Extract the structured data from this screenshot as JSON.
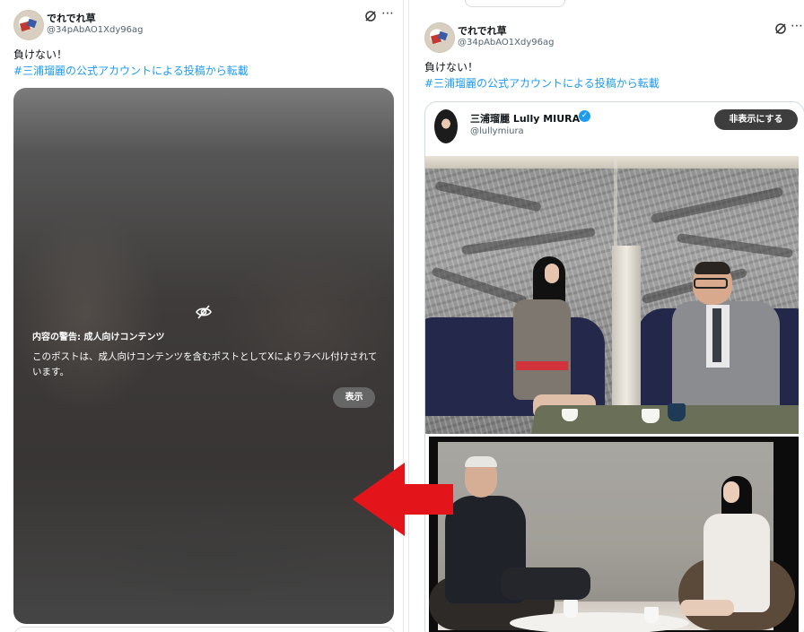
{
  "left_post": {
    "author_name": "でれでれ草",
    "author_handle": "@34pAbAO1Xdy96ag",
    "text_line1": "負けない！",
    "hashtag": "#三浦瑠麗の公式アカウントによる投稿から転載",
    "media_warning": {
      "title": "内容の警告: 成人向けコンテンツ",
      "body": "このポストは、成人向けコンテンツを含むポストとしてXによりラベル付けされています。",
      "show_button": "表示"
    }
  },
  "right_post": {
    "author_name": "でれでれ草",
    "author_handle": "@34pAbAO1Xdy96ag",
    "text_line1": "負けない！",
    "hashtag": "#三浦瑠麗の公式アカウントによる投稿から転載",
    "quoted": {
      "author_name": "三浦瑠麗 Lully MIURA",
      "author_handle": "@lullymiura",
      "verified": true,
      "hide_button": "非表示にする"
    }
  },
  "icons": {
    "grok": "grok-icon",
    "more": "more-icon",
    "hidden_eye": "eye-off-icon",
    "verified": "verified-badge-icon",
    "arrow": "red-arrow-icon"
  },
  "colors": {
    "accent_link": "#1d9bf0",
    "arrow_red": "#e3151a",
    "button_dark": "#3d3d3d"
  }
}
